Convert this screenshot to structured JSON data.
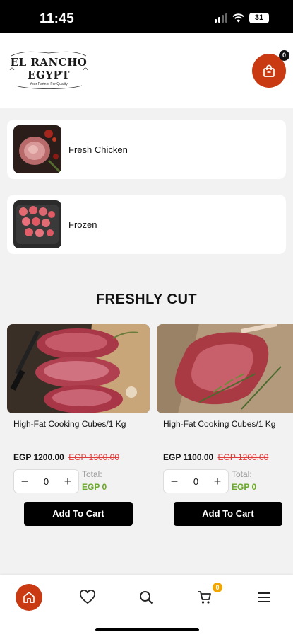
{
  "status_bar": {
    "time": "11:45",
    "battery": "31"
  },
  "header": {
    "logo_line1": "EL RANCHO",
    "logo_line2": "EGYPT",
    "logo_tagline": "Your Partner For Quality",
    "cart_count": "0"
  },
  "categories": [
    {
      "label": "Fresh Chicken",
      "icon": "chicken-thumbnail"
    },
    {
      "label": "Frozen",
      "icon": "frozen-meatballs-thumbnail"
    }
  ],
  "section_title": "FRESHLY CUT",
  "products": [
    {
      "name": "High-Fat Cooking Cubes/1 Kg",
      "price": "EGP 1200.00",
      "old_price": "EGP 1300.00",
      "quantity": "0",
      "total_label": "Total:",
      "total_value": "EGP 0",
      "add_label": "Add To Cart",
      "image": "steaks-on-board-photo"
    },
    {
      "name": "High-Fat Cooking Cubes/1 Kg",
      "price": "EGP 1100.00",
      "old_price": "EGP 1200.00",
      "quantity": "0",
      "total_label": "Total:",
      "total_value": "EGP 0",
      "add_label": "Add To Cart",
      "image": "ribeye-with-rosemary-photo"
    }
  ],
  "bottom_nav": {
    "items": [
      "home-icon",
      "heart-icon",
      "search-icon",
      "cart-icon",
      "menu-icon"
    ],
    "cart_count": "0"
  },
  "colors": {
    "accent": "#c93a12",
    "total_green": "#6aa82a",
    "old_price_red": "#e03b3b",
    "badge_orange": "#f0a500"
  }
}
